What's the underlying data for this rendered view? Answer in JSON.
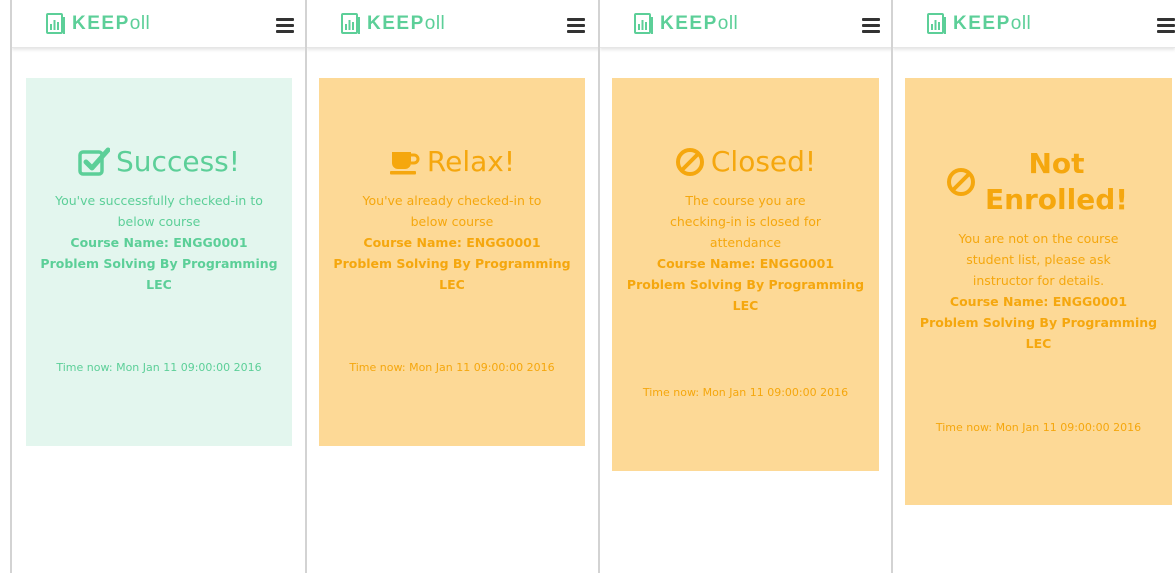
{
  "app": {
    "brand_bold": "KEEP",
    "brand_rest": "oll",
    "menu_icon": "hamburger-icon",
    "logo_icon": "poll-chart-icon"
  },
  "colors": {
    "success_text": "#5ccf98",
    "success_bg": "#e3f6ee",
    "warn_text": "#f5a70e",
    "warn_bg": "#fdd996"
  },
  "panels": [
    {
      "status": "success",
      "icon": "checkbox-icon",
      "title": "Success!",
      "message": "You've successfully checked-in to below course",
      "course": "Course Name: ENGG0001 Problem Solving By Programming LEC",
      "time": "Time now: Mon Jan 11 09:00:00 2016"
    },
    {
      "status": "relax",
      "icon": "coffee-cup-icon",
      "title": "Relax!",
      "message": "You've already checked-in to below course",
      "course": "Course Name: ENGG0001 Problem Solving By Programming LEC",
      "time": "Time now: Mon Jan 11 09:00:00 2016"
    },
    {
      "status": "closed",
      "icon": "ban-icon",
      "title": "Closed!",
      "message": "The course you are checking-in is closed for attendance",
      "course": "Course Name: ENGG0001 Problem Solving By Programming LEC",
      "time": "Time now: Mon Jan 11 09:00:00 2016"
    },
    {
      "status": "not-enrolled",
      "icon": "ban-icon",
      "title": "Not Enrolled!",
      "message": "You are not on the course student list, please ask instructor for details.",
      "course": "Course Name: ENGG0001 Problem Solving By Programming LEC",
      "time": "Time now: Mon Jan 11 09:00:00 2016"
    }
  ]
}
